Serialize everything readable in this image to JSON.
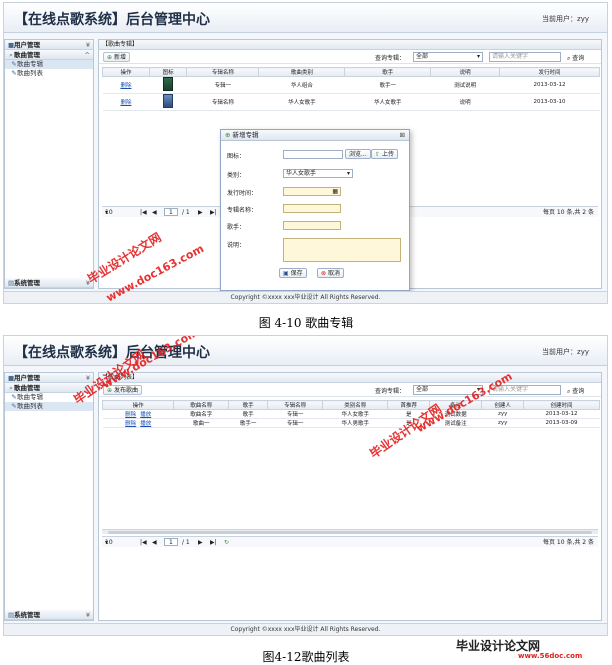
{
  "header": {
    "app_title": "【在线点歌系统】后台管理中心",
    "user_label": "当前用户：",
    "user_name": "zyy"
  },
  "sidebar": {
    "groups": [
      "用户管理",
      "歌曲管理",
      "系统管理"
    ],
    "items": [
      "歌曲专辑",
      "歌曲列表"
    ]
  },
  "footer": {
    "copyright": "Copyright ©xxxx xxx毕业设计 All Rights Reserved."
  },
  "album_screen": {
    "panel_title": "【歌曲专辑】",
    "add_button": "新增",
    "filter_label": "查询专辑：",
    "filter_value": "全部",
    "search_placeholder": "请输入关键字",
    "search_button": "查询",
    "columns": [
      "操作",
      "图标",
      "专辑名称",
      "歌曲类别",
      "歌手",
      "说明",
      "发行时间"
    ],
    "rows": [
      {
        "op": "删除",
        "album": "专辑一",
        "category": "华人组合",
        "singer": "歌手一",
        "desc": "测试说明",
        "date": "2013-03-12"
      },
      {
        "op": "删除",
        "album": "专辑名称",
        "category": "华人女歌手",
        "singer": "华人女歌手",
        "desc": "说明",
        "date": "2013-03-10"
      }
    ],
    "pager": {
      "page_size": "10",
      "page": "1",
      "total_pages": "/ 1",
      "summary": "每页 10 条,共 2 条"
    },
    "dialog": {
      "title": "新增专辑",
      "labels": [
        "图标：",
        "类别：",
        "发行时间：",
        "专辑名称：",
        "歌手：",
        "说明："
      ],
      "browse_button": "浏览...",
      "upload_button": "上传",
      "category_value": "华人女歌手",
      "save_button": "保存",
      "cancel_button": "取消"
    },
    "caption": "图 4-10 歌曲专辑"
  },
  "list_screen": {
    "panel_title": "【歌曲列表】",
    "add_button": "发布歌曲",
    "filter_label": "查询专辑：",
    "filter_value": "全部",
    "search_placeholder": "请输入关键字",
    "search_button": "查询",
    "columns": [
      "操作",
      "歌曲名称",
      "歌手",
      "专辑名称",
      "类别名称",
      "首推荐",
      "备注",
      "创建人",
      "创建时间"
    ],
    "rows": [
      {
        "op1": "删除",
        "op2": "播放",
        "song": "歌曲名字",
        "singer": "歌手",
        "album": "专辑一",
        "category": "华人女歌手",
        "recommend": "是",
        "note": "测试数据",
        "creator": "zyy",
        "date": "2013-03-12"
      },
      {
        "op1": "删除",
        "op2": "播放",
        "song": "歌曲一",
        "singer": "歌手一",
        "album": "专辑一",
        "category": "华人男歌手",
        "recommend": "是",
        "note": "测试备注",
        "creator": "zyy",
        "date": "2013-03-09"
      }
    ],
    "pager": {
      "page_size": "10",
      "page": "1",
      "total_pages": "/ 1",
      "summary": "每页 10 条,共 2 条"
    },
    "caption": "图4-12歌曲列表"
  },
  "watermarks": {
    "cn": "毕业设计论文网",
    "url": "www.doc163.com",
    "url2": "www.56doc.com"
  },
  "colors": {
    "watermark": "#e41e1e",
    "accent": "#1a4fb5"
  }
}
